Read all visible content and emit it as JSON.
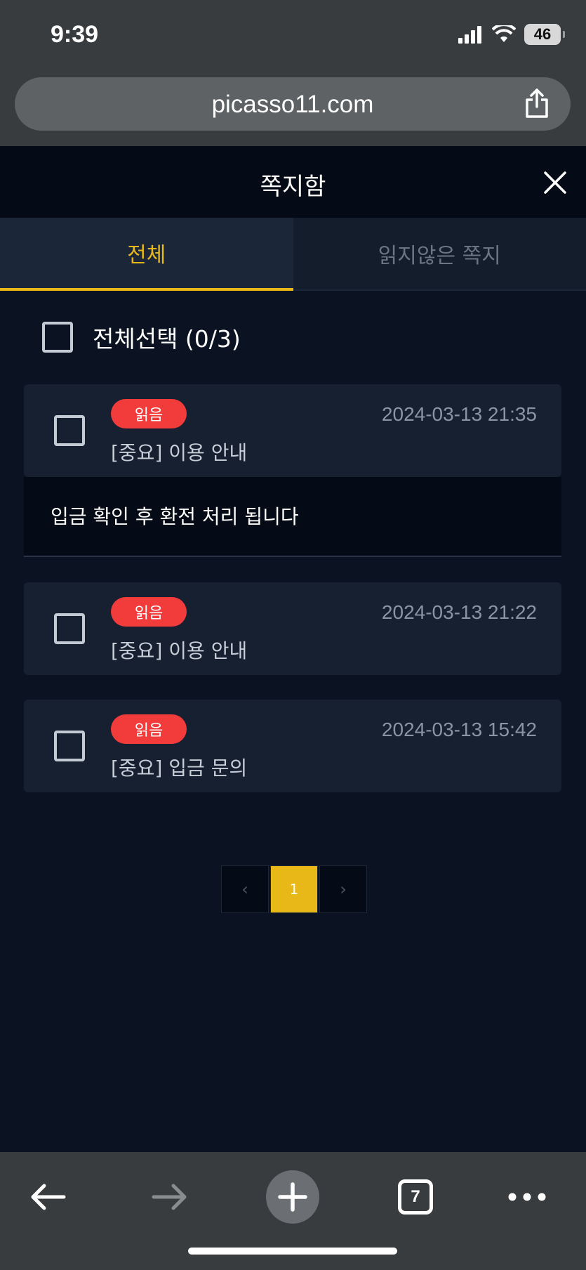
{
  "status_bar": {
    "time": "9:39",
    "battery": "46"
  },
  "browser": {
    "url": "picasso11.com",
    "tab_count": "7"
  },
  "modal": {
    "title": "쪽지함"
  },
  "tabs": [
    {
      "label": "전체",
      "active": true
    },
    {
      "label": "읽지않은 쪽지",
      "active": false
    }
  ],
  "select_all": {
    "label": "전체선택 (0/3)"
  },
  "messages": [
    {
      "badge": "읽음",
      "date": "2024-03-13 21:35",
      "subject": "[중요] 이용 안내",
      "body": "입금 확인 후 환전 처리 됩니다",
      "expanded": true
    },
    {
      "badge": "읽음",
      "date": "2024-03-13 21:22",
      "subject": "[중요] 이용 안내"
    },
    {
      "badge": "읽음",
      "date": "2024-03-13 15:42",
      "subject": "[중요] 입금 문의"
    }
  ],
  "pagination": {
    "prev": "‹",
    "current": "1",
    "next": "›"
  },
  "colors": {
    "accent": "#e8b818",
    "badge": "#f23b3b",
    "background": "#0b1322",
    "card": "#162031"
  }
}
